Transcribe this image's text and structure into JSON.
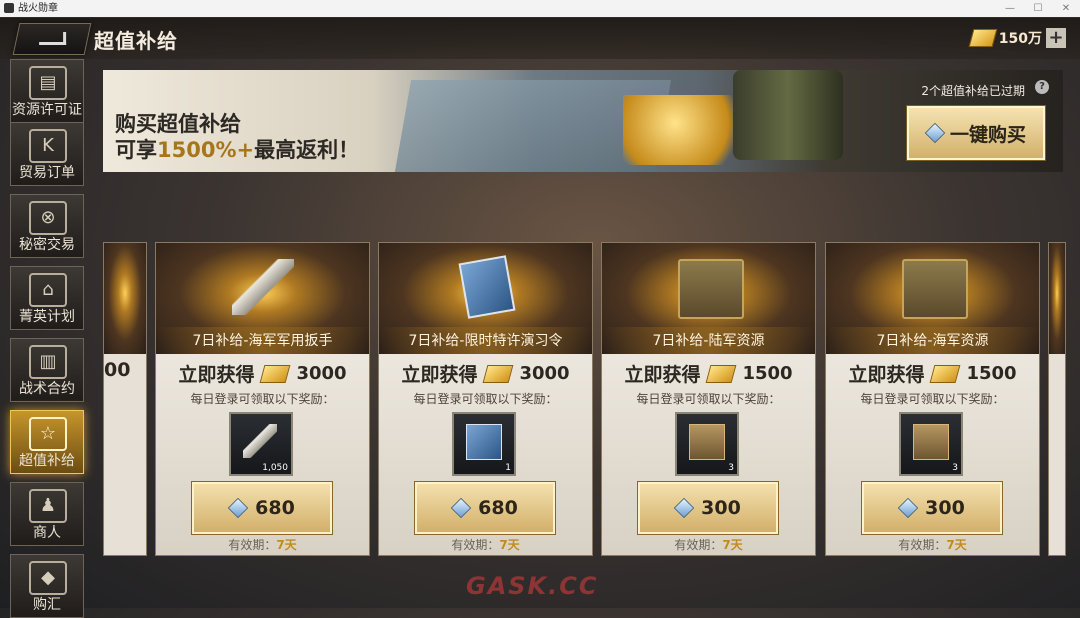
{
  "window": {
    "title": "战火勋章",
    "controls": [
      "—",
      "☐",
      "✕"
    ]
  },
  "header": {
    "title": "超值补给",
    "currency_amount": "150万",
    "plus": "+"
  },
  "sidebar": {
    "items": [
      {
        "label": "资源许可证",
        "icon": "permit-icon",
        "glyph": "▤",
        "active": false
      },
      {
        "label": "贸易订单",
        "icon": "trade-order-icon",
        "glyph": "K",
        "active": false
      },
      {
        "label": "秘密交易",
        "icon": "secret-trade-icon",
        "glyph": "⊗",
        "active": false
      },
      {
        "label": "菁英计划",
        "icon": "elite-plan-icon",
        "glyph": "⌂",
        "active": false
      },
      {
        "label": "战术合约",
        "icon": "tactical-contract-icon",
        "glyph": "▥",
        "active": false
      },
      {
        "label": "超值补给",
        "icon": "value-supply-icon",
        "glyph": "☆",
        "active": true
      },
      {
        "label": "商人",
        "icon": "merchant-icon",
        "glyph": "♟",
        "active": false
      },
      {
        "label": "购汇",
        "icon": "exchange-icon",
        "glyph": "◆",
        "active": false
      }
    ]
  },
  "banner": {
    "line1": "购买超值补给",
    "line2_prefix": "可享",
    "line2_highlight": "1500%+",
    "line2_suffix": "最高返利！",
    "expired_text": "2个超值补给已过期",
    "help": "?",
    "buy_all_label": "一键购买"
  },
  "partial_left": {
    "amount_fragment": "00"
  },
  "cards": [
    {
      "name": "7日补给-海军军用扳手",
      "obtain_label": "立即获得",
      "gold": "3000",
      "daily_text": "每日登录可领取以下奖励：",
      "reward_qty": "1,050",
      "price": "680",
      "validity_label": "有效期：",
      "validity_days": "7天",
      "icon": "wrench-icon"
    },
    {
      "name": "7日补给-限时特许演习令",
      "obtain_label": "立即获得",
      "gold": "3000",
      "daily_text": "每日登录可领取以下奖励：",
      "reward_qty": "1",
      "price": "680",
      "validity_label": "有效期：",
      "validity_days": "7天",
      "icon": "exercise-order-icon"
    },
    {
      "name": "7日补给-陆军资源",
      "obtain_label": "立即获得",
      "gold": "1500",
      "daily_text": "每日登录可领取以下奖励：",
      "reward_qty": "3",
      "price": "300",
      "validity_label": "有效期：",
      "validity_days": "7天",
      "icon": "army-resource-chest-icon"
    },
    {
      "name": "7日补给-海军资源",
      "obtain_label": "立即获得",
      "gold": "1500",
      "daily_text": "每日登录可领取以下奖励：",
      "reward_qty": "3",
      "price": "300",
      "validity_label": "有效期：",
      "validity_days": "7天",
      "icon": "navy-resource-chest-icon"
    }
  ],
  "watermark": "GASK.CC"
}
